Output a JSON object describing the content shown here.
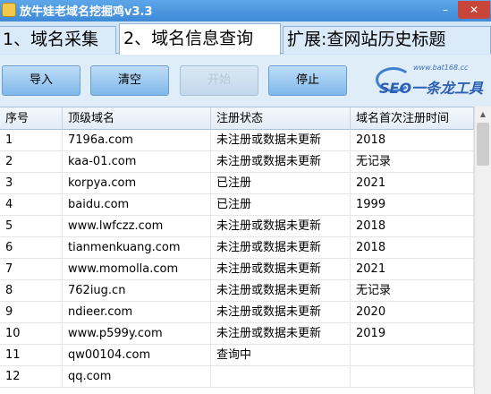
{
  "window": {
    "title": "放牛娃老域名挖掘鸡v3.3",
    "min_glyph": "–",
    "close_glyph": "✕"
  },
  "tabs": [
    {
      "label": "1、域名采集",
      "active": false
    },
    {
      "label": "2、域名信息查询",
      "active": true
    },
    {
      "label": "扩展:查网站历史标题",
      "active": false
    }
  ],
  "toolbar": {
    "import_label": "导入",
    "clear_label": "清空",
    "start_label": "开始",
    "stop_label": "停止"
  },
  "logo": {
    "url": "www.bat168.cc",
    "text": "SEO一条龙工具"
  },
  "table": {
    "headers": [
      "序号",
      "顶级域名",
      "注册状态",
      "域名首次注册时间"
    ],
    "rows": [
      [
        "1",
        "7196a.com",
        "未注册或数据未更新",
        "2018"
      ],
      [
        "2",
        "kaa-01.com",
        "未注册或数据未更新",
        "无记录"
      ],
      [
        "3",
        "korpya.com",
        "已注册",
        "2021"
      ],
      [
        "4",
        "baidu.com",
        "已注册",
        "1999"
      ],
      [
        "5",
        "www.lwfczz.com",
        "未注册或数据未更新",
        "2018"
      ],
      [
        "6",
        "tianmenkuang.com",
        "未注册或数据未更新",
        "2018"
      ],
      [
        "7",
        "www.momolla.com",
        "未注册或数据未更新",
        "2021"
      ],
      [
        "8",
        "762iug.cn",
        "未注册或数据未更新",
        "无记录"
      ],
      [
        "9",
        "ndieer.com",
        "未注册或数据未更新",
        "2020"
      ],
      [
        "10",
        "www.p599y.com",
        "未注册或数据未更新",
        "2019"
      ],
      [
        "11",
        "qw00104.com",
        "查询中",
        ""
      ],
      [
        "12",
        "qq.com",
        "",
        ""
      ]
    ]
  },
  "scrollbar": {
    "up_glyph": "▲"
  }
}
